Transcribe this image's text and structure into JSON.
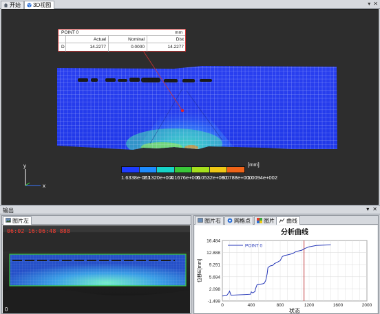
{
  "top_tabs": [
    {
      "label": "开始",
      "icon": "home-icon"
    },
    {
      "label": "3D视图",
      "icon": "cube-icon"
    }
  ],
  "window_controls": [
    "pin-icon",
    "close-icon"
  ],
  "point_box": {
    "title": "POINT 0",
    "unit": "mm",
    "columns": [
      "",
      "Actual",
      "Nominal",
      "Dist"
    ],
    "row": [
      "D",
      "14.2277",
      "0.0000",
      "14.2277"
    ]
  },
  "legend": {
    "unit": "[mm]",
    "ticks": [
      "1.6338e-001",
      "2.1320e+000",
      "4.1676e+000",
      "6.0532e+000",
      "8.0788e+000",
      "1.0094e+002"
    ],
    "colors": [
      "#1e3cff",
      "#1e8cff",
      "#16d4c8",
      "#3ac83a",
      "#a6e01c",
      "#f0c814",
      "#f06418"
    ]
  },
  "axes": {
    "y": "y",
    "x": "x"
  },
  "output": {
    "title": "输出",
    "controls": [
      "pin-icon",
      "close-icon"
    ]
  },
  "left_panel": {
    "tab": "图片左",
    "timestamp": "06:02 16:06:48 888",
    "frame": "0"
  },
  "right_panel": {
    "tabs": [
      "图片右",
      "网格点",
      "图片",
      "曲线"
    ],
    "active_tab": "曲线"
  },
  "chart_data": {
    "type": "line",
    "title": "分析曲线",
    "xlabel": "状态",
    "ylabel": "位移E[mm]",
    "xlim": [
      0,
      2000
    ],
    "ylim": [
      -1.499,
      16.484
    ],
    "xticks": [
      0,
      400,
      800,
      1200,
      1600,
      2000
    ],
    "yticks": [
      "-1.499",
      "2.098",
      "5.694",
      "9.291",
      "12.888",
      "16.484"
    ],
    "series": [
      {
        "name": "POINT 0",
        "color": "#2436b8",
        "x": [
          0,
          60,
          90,
          100,
          120,
          200,
          300,
          390,
          400,
          420,
          450,
          460,
          480,
          560,
          580,
          600,
          620,
          630,
          660,
          700,
          720,
          760,
          800,
          830,
          860,
          900,
          940,
          980,
          1020,
          1060,
          1100,
          1140,
          1200,
          1300,
          1400,
          1500
        ],
        "values": [
          0.0,
          0.1,
          1.0,
          1.4,
          0.2,
          0.3,
          0.4,
          0.5,
          1.2,
          0.9,
          1.3,
          2.2,
          3.3,
          3.6,
          3.8,
          4.6,
          6.6,
          8.4,
          8.9,
          9.1,
          9.6,
          10.0,
          10.5,
          11.7,
          12.0,
          12.2,
          12.4,
          12.7,
          13.2,
          13.4,
          13.6,
          14.1,
          14.6,
          15.0,
          15.1,
          15.2
        ]
      }
    ],
    "marker_x": 1130,
    "marker_color": "#c0383a",
    "grid": true,
    "legend_position": "top-left"
  }
}
